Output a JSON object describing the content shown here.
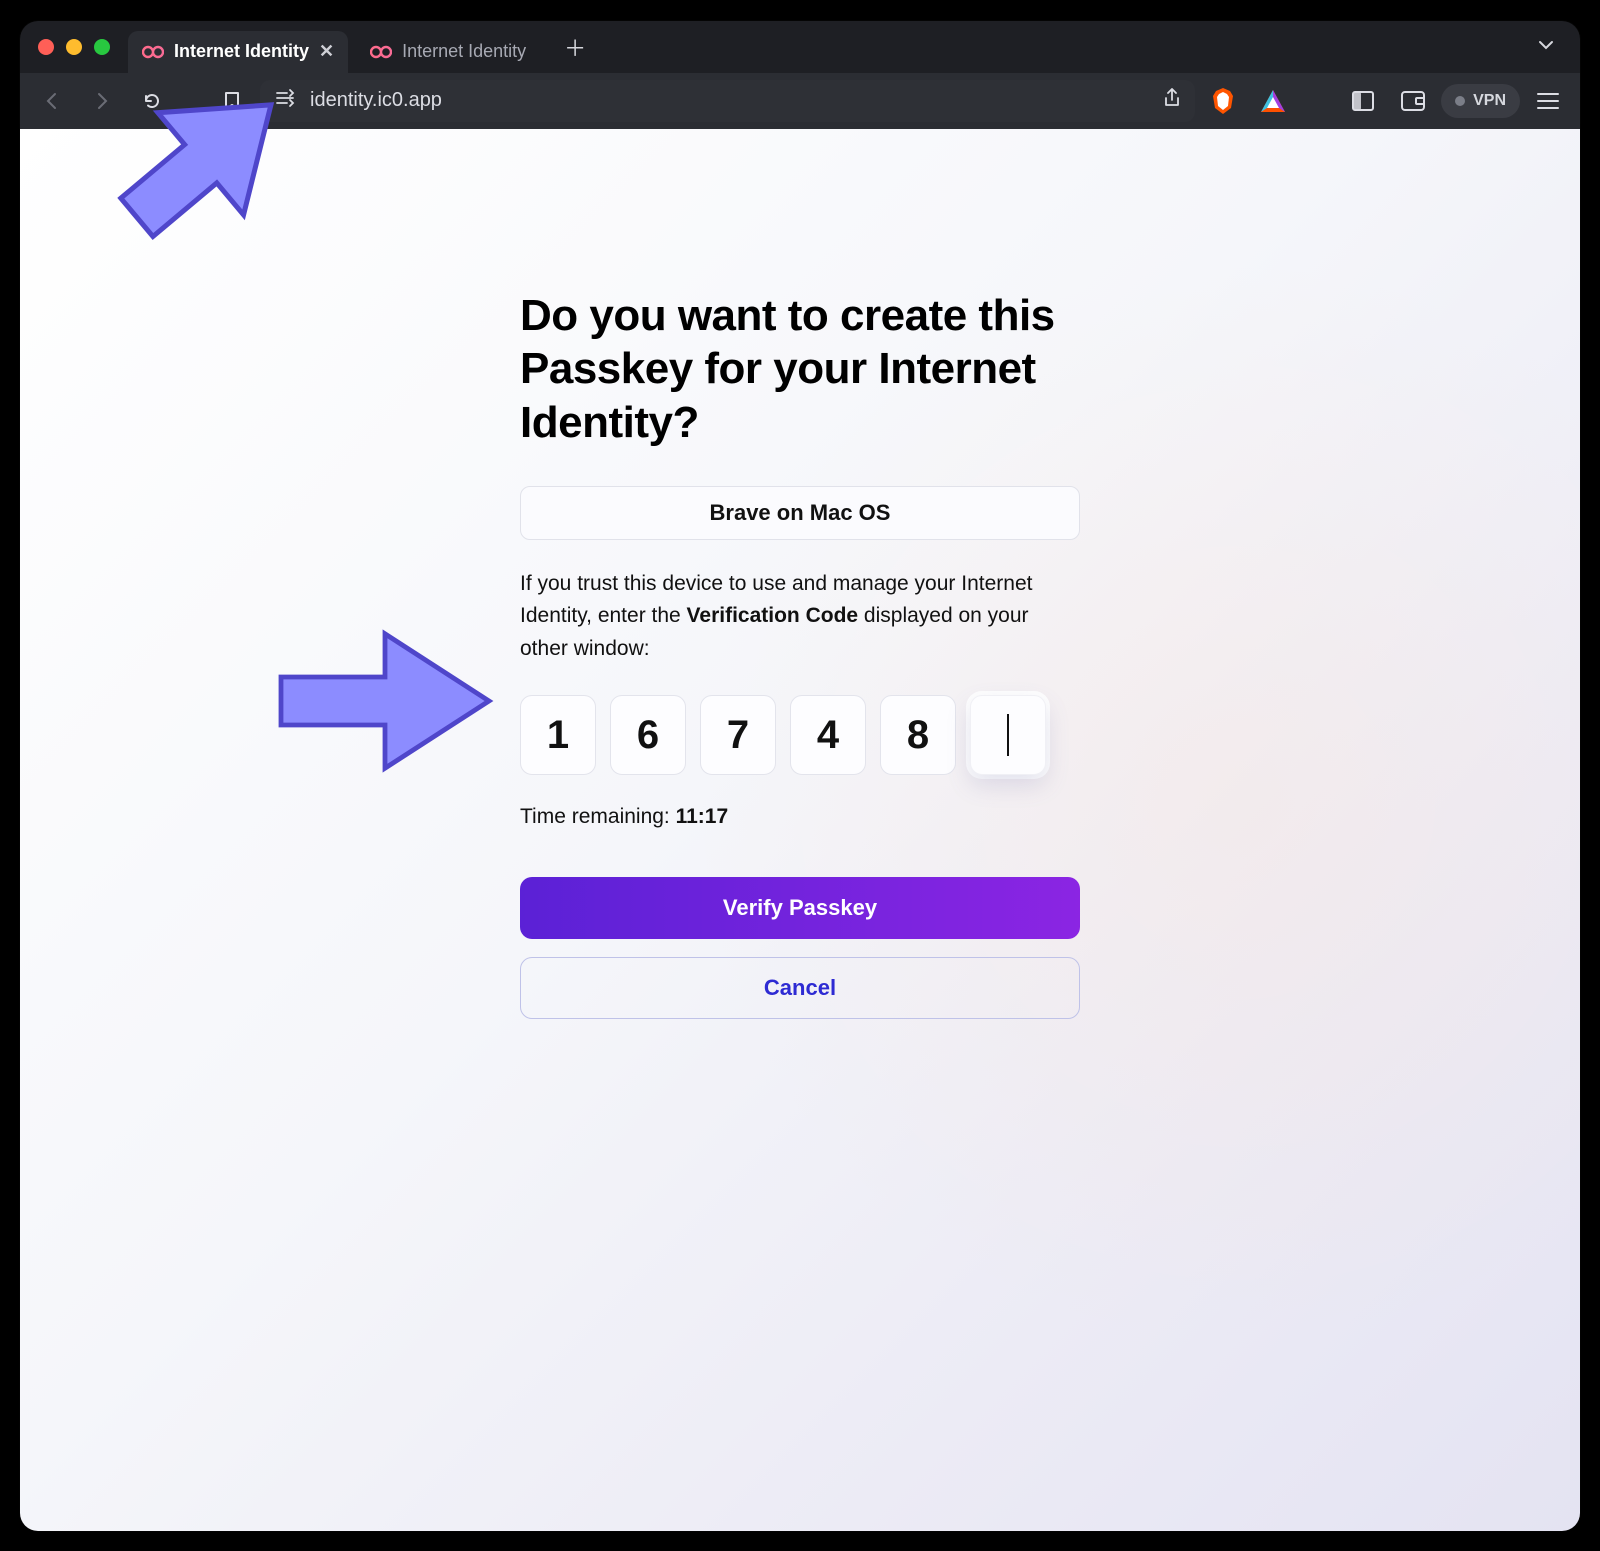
{
  "window": {
    "traffic_lights": [
      "close",
      "minimize",
      "zoom"
    ]
  },
  "tabs": [
    {
      "title": "Internet Identity",
      "active": true
    },
    {
      "title": "Internet Identity",
      "active": false
    }
  ],
  "toolbar": {
    "url": "identity.ic0.app",
    "vpn_label": "VPN"
  },
  "page": {
    "heading": "Do you want to create this Passkey for your Internet Identity?",
    "device_label": "Brave on Mac OS",
    "instruction_pre": "If you trust this device to use and manage your Internet Identity, enter the ",
    "instruction_strong": "Verification Code",
    "instruction_post": " displayed on your other window:",
    "code": [
      "1",
      "6",
      "7",
      "4",
      "8",
      ""
    ],
    "timer_label": "Time remaining: ",
    "timer_value": "11:17",
    "verify_label": "Verify Passkey",
    "cancel_label": "Cancel"
  },
  "colors": {
    "accent": "#8c8cff",
    "primary_gradient_start": "#5b21d6",
    "primary_gradient_end": "#8b25e3"
  }
}
